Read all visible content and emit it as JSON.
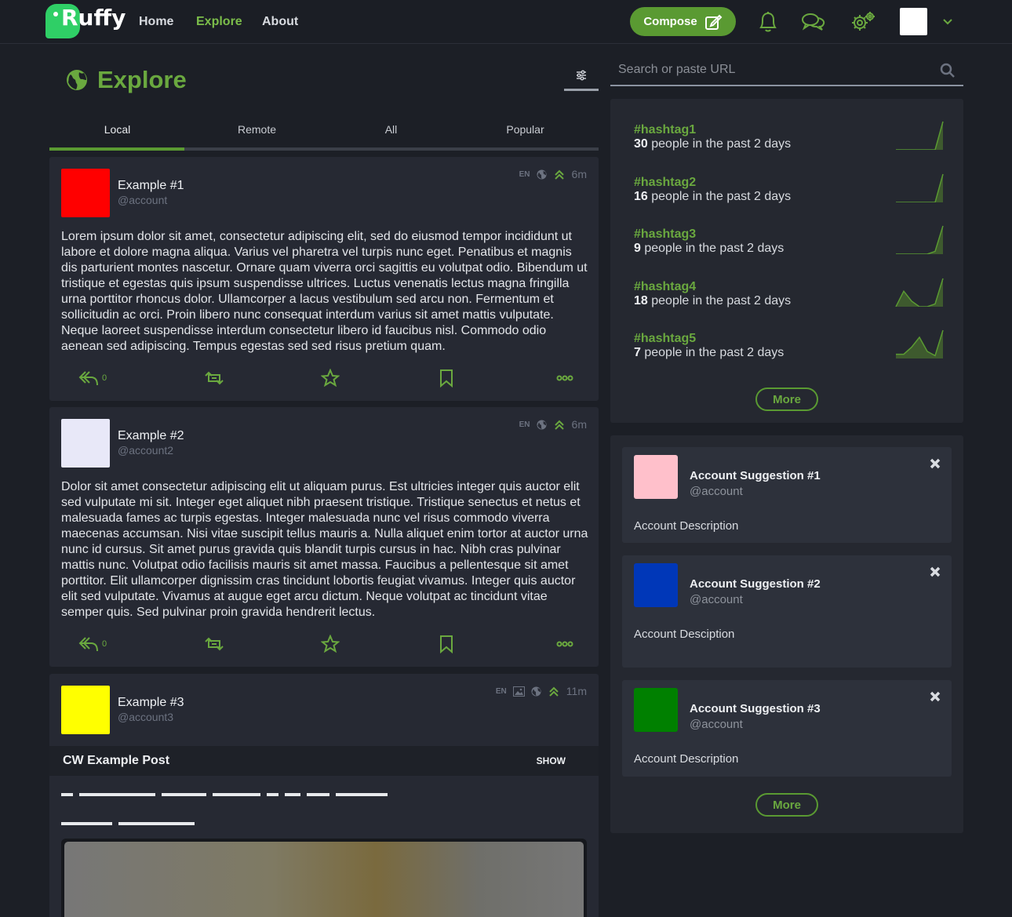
{
  "nav": {
    "logo_text": "Ruffy",
    "links": [
      "Home",
      "Explore",
      "About"
    ],
    "compose_label": "Compose"
  },
  "explore": {
    "title": "Explore",
    "tabs": [
      "Local",
      "Remote",
      "All",
      "Popular"
    ],
    "active_tab": "Local"
  },
  "posts": [
    {
      "name": "Example #1",
      "handle": "@account",
      "lang": "EN",
      "time": "6m",
      "avatar_color": "#ff0000",
      "body": "Lorem ipsum dolor sit amet, consectetur adipiscing elit, sed do eiusmod tempor incididunt ut labore et dolore magna aliqua. Varius vel pharetra vel turpis nunc eget. Penatibus et magnis dis parturient montes nascetur. Ornare quam viverra orci sagittis eu volutpat odio. Bibendum ut tristique et egestas quis ipsum suspendisse ultrices. Luctus venenatis lectus magna fringilla urna porttitor rhoncus dolor. Ullamcorper a lacus vestibulum sed arcu non. Fermentum et sollicitudin ac orci. Proin libero nunc consequat interdum varius sit amet mattis vulputate. Neque laoreet suspendisse interdum consectetur libero id faucibus nisl. Commodo odio aenean sed adipiscing. Tempus egestas sed sed risus pretium quam.",
      "reply_count": "0"
    },
    {
      "name": "Example #2",
      "handle": "@account2",
      "lang": "EN",
      "time": "6m",
      "avatar_color": "#e8e8f8",
      "body": "Dolor sit amet consectetur adipiscing elit ut aliquam purus. Est ultricies integer quis auctor elit sed vulputate mi sit. Integer eget aliquet nibh praesent tristique. Tristique senectus et netus et malesuada fames ac turpis egestas. Integer malesuada nunc vel risus commodo viverra maecenas accumsan. Nisi vitae suscipit tellus mauris a. Nulla aliquet enim tortor at auctor urna nunc id cursus. Sit amet purus gravida quis blandit turpis cursus in hac. Nibh cras pulvinar mattis nunc. Volutpat odio facilisis mauris sit amet massa. Faucibus a pellentesque sit amet porttitor. Elit ullamcorper dignissim cras tincidunt lobortis feugiat vivamus. Integer quis auctor elit sed vulputate. Vivamus at augue eget arcu dictum. Neque volutpat ac tincidunt vitae semper quis. Sed pulvinar proin gravida hendrerit lectus.",
      "reply_count": "0"
    },
    {
      "name": "Example #3",
      "handle": "@account3",
      "lang": "EN",
      "time": "11m",
      "avatar_color": "#ffff00",
      "cw_title": "CW Example Post",
      "cw_show": "SHOW"
    }
  ],
  "search": {
    "placeholder": "Search or paste URL"
  },
  "trends": {
    "items": [
      {
        "tag": "#hashtag1",
        "count": "30",
        "suffix": " people in the past 2 days",
        "spark": [
          0,
          0,
          0,
          0,
          0,
          0,
          1
        ]
      },
      {
        "tag": "#hashtag2",
        "count": "16",
        "suffix": " people in the past 2 days",
        "spark": [
          0,
          0,
          0,
          0,
          0,
          0,
          1
        ]
      },
      {
        "tag": "#hashtag3",
        "count": "9",
        "suffix": " people in the past 2 days",
        "spark": [
          0,
          0,
          0,
          0,
          0,
          0.1,
          1
        ]
      },
      {
        "tag": "#hashtag4",
        "count": "18",
        "suffix": " people in the past 2 days",
        "spark": [
          0,
          0.55,
          0.2,
          0,
          0,
          0.1,
          1
        ]
      },
      {
        "tag": "#hashtag5",
        "count": "7",
        "suffix": " people in the past 2 days",
        "spark": [
          0.15,
          0.15,
          0.4,
          0.75,
          0.25,
          0.1,
          1
        ]
      }
    ],
    "more_label": "More"
  },
  "suggestions": {
    "items": [
      {
        "name": "Account Suggestion #1",
        "handle": "@account",
        "desc": "Account Description",
        "avatar_color": "#ffc0cb"
      },
      {
        "name": "Account Suggestion #2",
        "handle": "@account",
        "desc": "Account Desciption",
        "avatar_color": "#0037b8"
      },
      {
        "name": "Account Suggestion #3",
        "handle": "@account",
        "desc": "Account Description",
        "avatar_color": "#008000"
      }
    ],
    "more_label": "More"
  },
  "colors": {
    "accent": "#6aa83f",
    "accent_dark": "#5a9a32",
    "bg": "#1c1f26",
    "card": "#262933"
  }
}
